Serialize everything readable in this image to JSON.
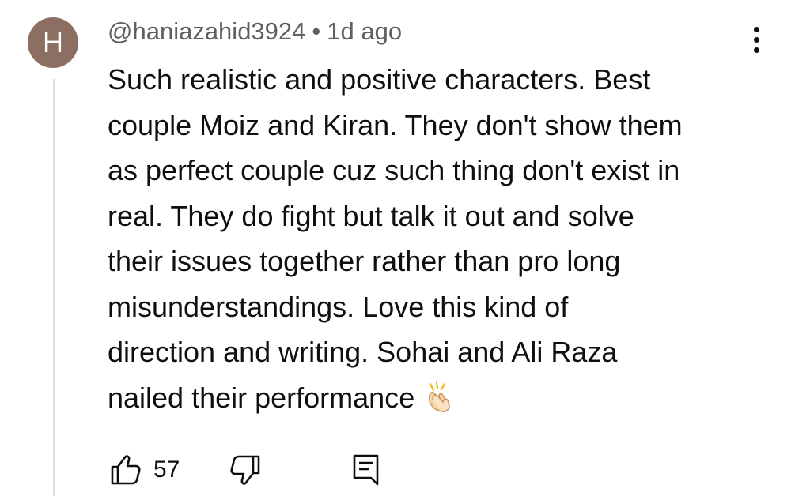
{
  "comment": {
    "avatar_initial": "H",
    "avatar_color": "#8d6e63",
    "author": "@haniazahid3924",
    "separator": "•",
    "timestamp": "1d ago",
    "body_lines": [
      "Such realistic and positive characters. Best",
      "couple Moiz and Kiran. They don't show them",
      "as perfect couple cuz such thing don't exist in",
      "real. They do fight but talk it out and solve",
      "their issues together rather than pro long",
      "misunderstandings. Love this kind of",
      "direction and writing. Sohai and Ali Raza",
      "nailed their performance"
    ],
    "emoji": "clapping-hands-emoji",
    "like_count": "57",
    "icons": {
      "more": "more-vert-icon",
      "like": "thumb-up-icon",
      "dislike": "thumb-down-icon",
      "reply": "reply-comment-icon"
    }
  }
}
